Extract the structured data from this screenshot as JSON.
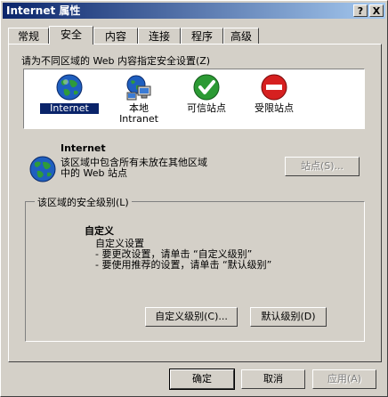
{
  "window": {
    "title": "Internet 属性",
    "help_button": "?",
    "close_button": "X"
  },
  "tabs": [
    {
      "label": "常规"
    },
    {
      "label": "安全"
    },
    {
      "label": "内容"
    },
    {
      "label": "连接"
    },
    {
      "label": "程序"
    },
    {
      "label": "高级"
    }
  ],
  "security": {
    "zone_prompt": "请为不同区域的 Web 内容指定安全设置(Z)",
    "zones": [
      {
        "label": "Internet",
        "icon": "globe-icon"
      },
      {
        "label": "本地\nIntranet",
        "icon": "local-intranet-icon"
      },
      {
        "label": "可信站点",
        "icon": "trusted-sites-icon"
      },
      {
        "label": "受限站点",
        "icon": "restricted-sites-icon"
      }
    ],
    "selected_zone": {
      "name": "Internet",
      "desc_line1": "该区域中包含所有未放在其他区域",
      "desc_line2": "中的 Web 站点"
    },
    "sites_button": "站点(S)...",
    "group_label": "该区域的安全级别(L)",
    "level_name": "自定义",
    "level_line1": "自定义设置",
    "level_line2": "- 要更改设置，请单击 “自定义级别”",
    "level_line3": "- 要使用推荐的设置，请单击 “默认级别”",
    "custom_level_button": "自定义级别(C)...",
    "default_level_button": "默认级别(D)"
  },
  "footer": {
    "ok": "确定",
    "cancel": "取消",
    "apply": "应用(A)"
  },
  "colors": {
    "face": "#d4d0c8",
    "title_start": "#0a246a",
    "title_end": "#a6caf0"
  }
}
